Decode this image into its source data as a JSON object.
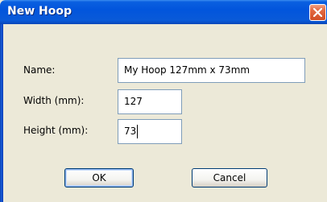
{
  "window": {
    "title": "New Hoop",
    "close_icon": "close-x-icon"
  },
  "form": {
    "name": {
      "label": "Name:",
      "value": "My Hoop 127mm x 73mm"
    },
    "width": {
      "label": "Width (mm):",
      "value": "127"
    },
    "height": {
      "label": "Height (mm):",
      "value": "73"
    }
  },
  "buttons": {
    "ok": "OK",
    "cancel": "Cancel"
  },
  "colors": {
    "titlebar": "#0255dc",
    "dialog_bg": "#ece9d8",
    "close_button": "#e46a42",
    "input_border": "#7f9db9",
    "default_button_border": "#003c74"
  }
}
